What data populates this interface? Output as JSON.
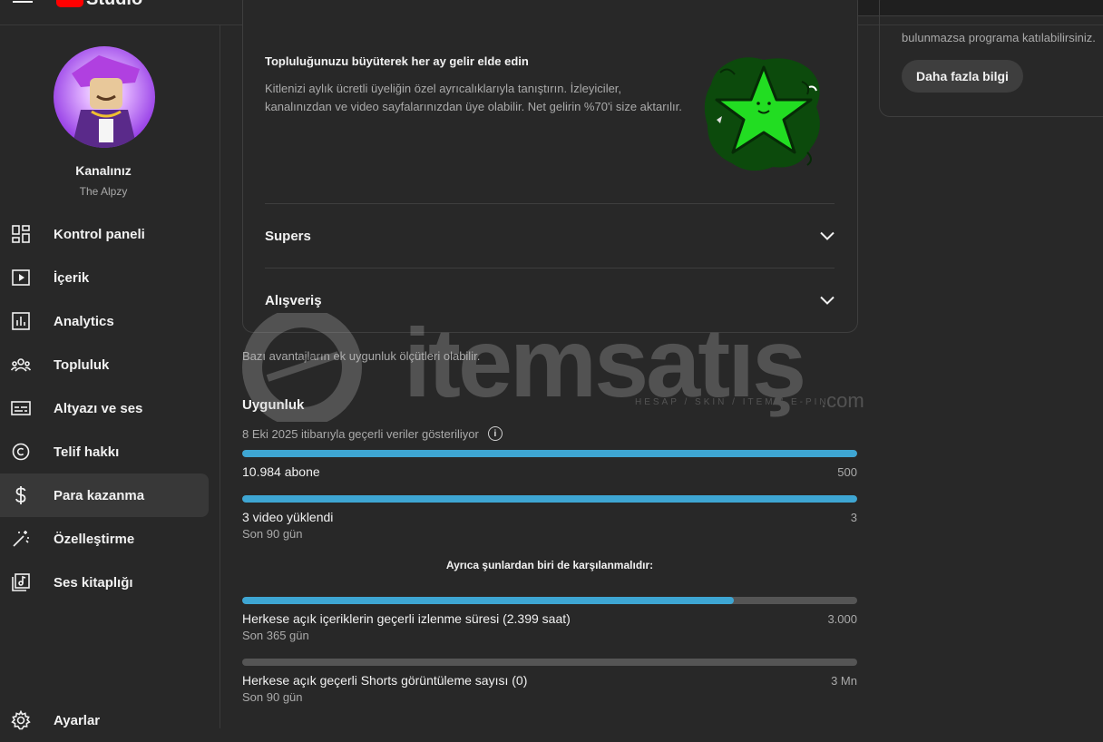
{
  "app": {
    "logo_text": "Studio"
  },
  "sidebar": {
    "channel_title": "Kanalınız",
    "channel_name": "The Alpzy",
    "items": [
      {
        "label": "Kontrol paneli",
        "icon": "dashboard-icon"
      },
      {
        "label": "İçerik",
        "icon": "content-icon"
      },
      {
        "label": "Analytics",
        "icon": "analytics-icon"
      },
      {
        "label": "Topluluk",
        "icon": "community-icon"
      },
      {
        "label": "Altyazı ve ses",
        "icon": "subtitles-icon"
      },
      {
        "label": "Telif hakkı",
        "icon": "copyright-icon"
      },
      {
        "label": "Para kazanma",
        "icon": "dollar-icon",
        "active": true
      },
      {
        "label": "Özelleştirme",
        "icon": "magic-wand-icon"
      },
      {
        "label": "Ses kitaplığı",
        "icon": "audio-library-icon"
      }
    ],
    "settings_label": "Ayarlar"
  },
  "membership": {
    "heading": "Topluluğunuzu büyüterek her ay gelir elde edin",
    "description": "Kitlenizi aylık ücretli üyeliğin özel ayrıcalıklarıyla tanıştırın. İzleyiciler, kanalınızdan ve video sayfalarınızdan üye olabilir. Net gelirin %70'i size aktarılır.",
    "accordions": [
      {
        "label": "Supers"
      },
      {
        "label": "Alışveriş"
      }
    ]
  },
  "note": "Bazı avantajların ek uygunluk ölçütleri olabilir.",
  "eligibility": {
    "title": "Uygunluk",
    "date_text": "8 Eki 2025 itibarıyla geçerli veriler gösteriliyor",
    "requirements": [
      {
        "label": "10.984 abone",
        "target": "500",
        "progress": 1.0
      },
      {
        "label": "3 video yüklendi",
        "sublabel": "Son 90 gün",
        "target": "3",
        "progress": 1.0
      }
    ],
    "also_required": "Ayrıca şunlardan biri de karşılanmalıdır:",
    "alternatives": [
      {
        "label": "Herkese açık içeriklerin geçerli izlenme süresi (2.399 saat)",
        "sublabel": "Son 365 gün",
        "target": "3.000",
        "progress": 0.7997
      },
      {
        "label": "Herkese açık geçerli Shorts görüntüleme sayısı (0)",
        "sublabel": "Son 90 gün",
        "target": "3 Mn",
        "progress": 0
      }
    ]
  },
  "right_panel": {
    "text": "bulunmazsa programa katılabilirsiniz.",
    "button": "Daha fazla bilgi"
  },
  "watermark": {
    "text": "itemsatış",
    "tagline": "HESAP / SKIN / ITEM / E-PIN",
    "suffix": ".com"
  },
  "colors": {
    "progress_fill": "#3ea6d3",
    "progress_track": "#555555",
    "background": "#282828",
    "star_green": "#22dd22"
  }
}
